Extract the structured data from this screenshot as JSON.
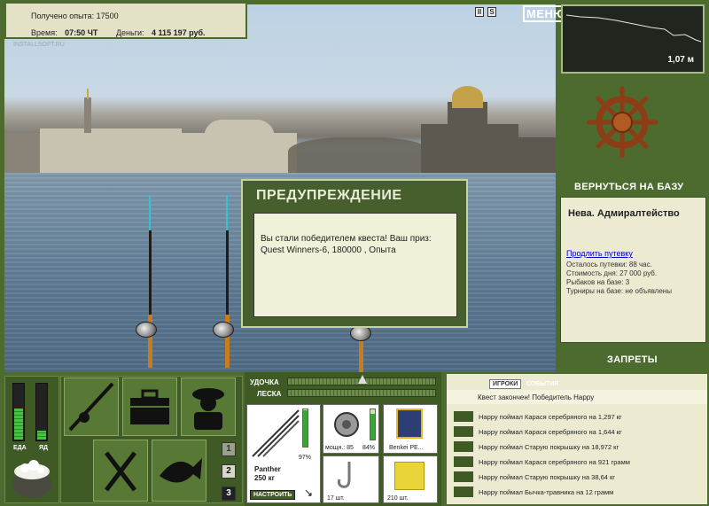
{
  "info": {
    "exp_label": "Получено опыта:",
    "exp_value": "17500",
    "time_label": "Время:",
    "time_value": "07:50 ЧТ",
    "money_label": "Деньги:",
    "money_value": "4 115 197 руб."
  },
  "watermark": "INSTALLSOFT.RU",
  "top": {
    "pause_icon": "II",
    "sound_icon": "S",
    "menu_label": "МЕНЮ"
  },
  "depth": {
    "value": "1,07 м"
  },
  "right": {
    "return_label": "ВЕРНУТЬСЯ НА БАЗУ",
    "location": "Нева. Адмиралтейство",
    "extend_link": "Продлить путевку",
    "lines": [
      "Осталось путевки: 88 час.",
      "Стоимость дня: 27 000 руб.",
      "Рыбаков на базе: 3",
      "Турниры на базе: не объявлены"
    ],
    "bans_label": "ЗАПРЕТЫ"
  },
  "dialog": {
    "title": "ПРЕДУПРЕЖДЕНИЕ",
    "body": "Вы стали победителем квеста! Ваш приз: Quest Winners-6, 180000 , Опыта"
  },
  "bottom": {
    "eat_label": "ЕДА",
    "poison_label": "ЯД",
    "eat_level": 0.55,
    "poison_level": 0.15,
    "slot_numbers": [
      "1",
      "2",
      "3"
    ]
  },
  "tackle": {
    "rod_label": "УДОЧКА",
    "line_label": "ЛЕСКА",
    "rod_name": "Panther",
    "rod_weight": "250 кг",
    "rod_percent": "97%",
    "rod_level": 0.97,
    "reel_power": "мощн.: 85",
    "reel_percent": "84%",
    "reel_level": 0.84,
    "line_name": "Benkei PE...",
    "hooks_count": "17 шт.",
    "bait_count": "210 шт.",
    "setup_button": "НАСТРОИТЬ"
  },
  "events": {
    "tab_players": "ИГРОКИ",
    "tab_events": "СОБЫТИЯ",
    "first_line": "Квест закончен! Победитель Happy",
    "rows": [
      "Happy поймал Карася серебряного на 1,297 кг",
      "Happy поймал Карася серебряного на 1,644 кг",
      "Happy поймал Старую покрышку на 18,972 кг",
      "Happy поймал Карася серебряного на 921 грамм",
      "Happy поймал Старую покрышку на 38,64 кг",
      "Happy поймал Бычка-травника на 12 грамм"
    ]
  }
}
